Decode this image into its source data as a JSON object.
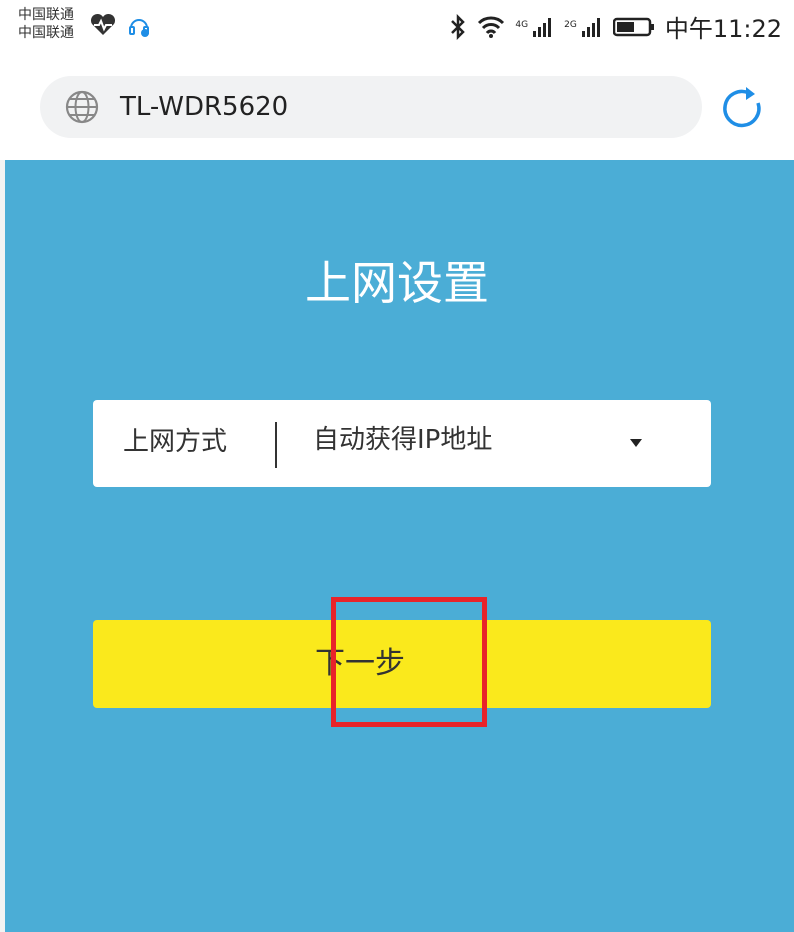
{
  "status_bar": {
    "carrier_1": "中国联通",
    "carrier_2": "中国联通",
    "network_1": "4G",
    "network_2": "2G",
    "time": "中午11:22",
    "icons": [
      "heart-rate-icon",
      "headset-icon",
      "bluetooth-icon",
      "wifi-icon",
      "signal-icon",
      "battery-icon"
    ]
  },
  "browser": {
    "url": "TL-WDR5620",
    "icons": [
      "globe-icon",
      "reload-icon"
    ]
  },
  "page": {
    "title": "上网设置",
    "connection_label": "上网方式",
    "connection_value": "自动获得IP地址",
    "next_label": "下一步"
  },
  "colors": {
    "background": "#4badd6",
    "button": "#fae91c",
    "highlight": "#e8242a",
    "accent": "#1f8ee6"
  }
}
